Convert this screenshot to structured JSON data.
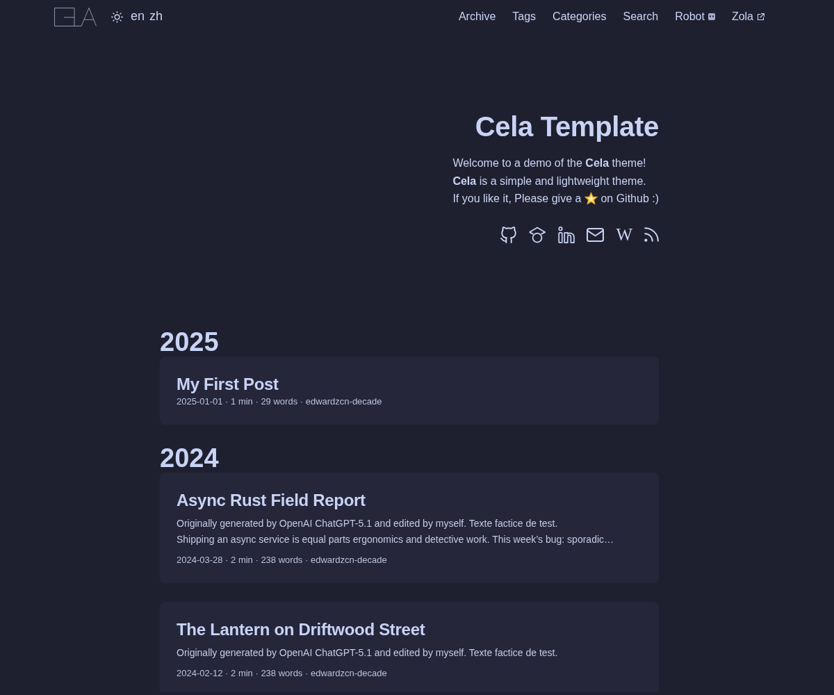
{
  "header": {
    "languages": [
      "en",
      "zh"
    ],
    "nav": [
      {
        "label": "Archive",
        "kind": "plain"
      },
      {
        "label": "Tags",
        "kind": "plain"
      },
      {
        "label": "Categories",
        "kind": "plain"
      },
      {
        "label": "Search",
        "kind": "plain"
      },
      {
        "label": "Robot",
        "kind": "robot"
      },
      {
        "label": "Zola",
        "kind": "external"
      }
    ]
  },
  "hero": {
    "title": "Cela Template",
    "intro_lines": [
      "Welcome to a demo of the **Cela** theme!",
      "**Cela** is a simple and lightweight theme."
    ],
    "star_line": {
      "before": "If you like it, Please give a",
      "after": "on Github :)"
    },
    "social_links": [
      {
        "kind": "github"
      },
      {
        "kind": "scholar"
      },
      {
        "kind": "linkedin"
      },
      {
        "kind": "mail"
      },
      {
        "kind": "glyph",
        "glyph": "W"
      },
      {
        "kind": "rss"
      }
    ]
  },
  "years": [
    {
      "year": "2025",
      "posts": [
        {
          "title": "My First Post",
          "meta": "2025-01-01 · 1 min · 29 words · edwardzcn-decade"
        }
      ]
    },
    {
      "year": "2024",
      "posts": [
        {
          "title": "Async Rust Field Report",
          "summary": [
            "Originally generated by OpenAI ChatGPT-5.1 and edited by myself. Texte factice de test.",
            "Shipping an async service is equal parts ergonomics and detective work. This week’s bug: sporadic…"
          ],
          "meta": "2024-03-28 · 2 min · 238 words · edwardzcn-decade"
        },
        {
          "title": "The Lantern on Driftwood Street",
          "summary": [
            "Originally generated by OpenAI ChatGPT-5.1 and edited by myself. Texte factice de test."
          ],
          "meta": "2024-02-12 · 2 min · 238 words · edwardzcn-decade"
        }
      ]
    }
  ]
}
